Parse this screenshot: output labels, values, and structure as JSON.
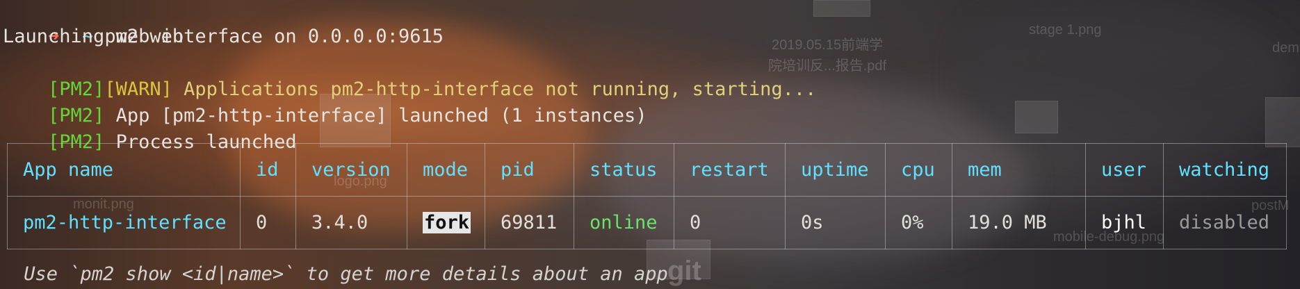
{
  "prompt": {
    "arrow_icon": "right-arrow-icon",
    "tilde": "~",
    "command": "pm2 web"
  },
  "output": {
    "launching": "Launching web interface on 0.0.0.0:9615",
    "warn_line": {
      "pm2_tag": "[PM2]",
      "warn_tag": "[WARN]",
      "text": " Applications pm2-http-interface not running, starting..."
    },
    "launched_line": {
      "pm2_tag": "[PM2]",
      "text": " App [pm2-http-interface] launched (1 instances)"
    },
    "process_line": {
      "pm2_tag": "[PM2]",
      "text": " Process launched"
    }
  },
  "table": {
    "headers": [
      "App name",
      "id",
      "version",
      "mode",
      "pid",
      "status",
      "restart",
      "uptime",
      "cpu",
      "mem",
      "user",
      "watching"
    ],
    "rows": [
      {
        "app_name": "pm2-http-interface",
        "id": "0",
        "version": "3.4.0",
        "mode": "fork",
        "pid": "69811",
        "status": "online",
        "restart": "0",
        "uptime": "0s",
        "cpu": "0%",
        "mem": "19.0 MB",
        "user": "bjhl",
        "watching": "disabled"
      }
    ]
  },
  "hint": " Use `pm2 show <id|name>` to get more details about an app",
  "desktop_labels": {
    "file1": "2019.05.15前端学",
    "file1b": "院培训反...报告.pdf",
    "file2": "stage 1.png",
    "file3": "dem",
    "file4": "logo.png",
    "file5": "monit.png",
    "file6": "postM",
    "file7": "mobile-debug.png",
    "file8": "git"
  },
  "colors": {
    "arrow": "#ff6b5a",
    "pm2_tag": "#64d63a",
    "warn_tag": "#d9c43a",
    "header": "#5fe1ff",
    "online": "#6be36b",
    "disabled": "#9a9a9a"
  }
}
